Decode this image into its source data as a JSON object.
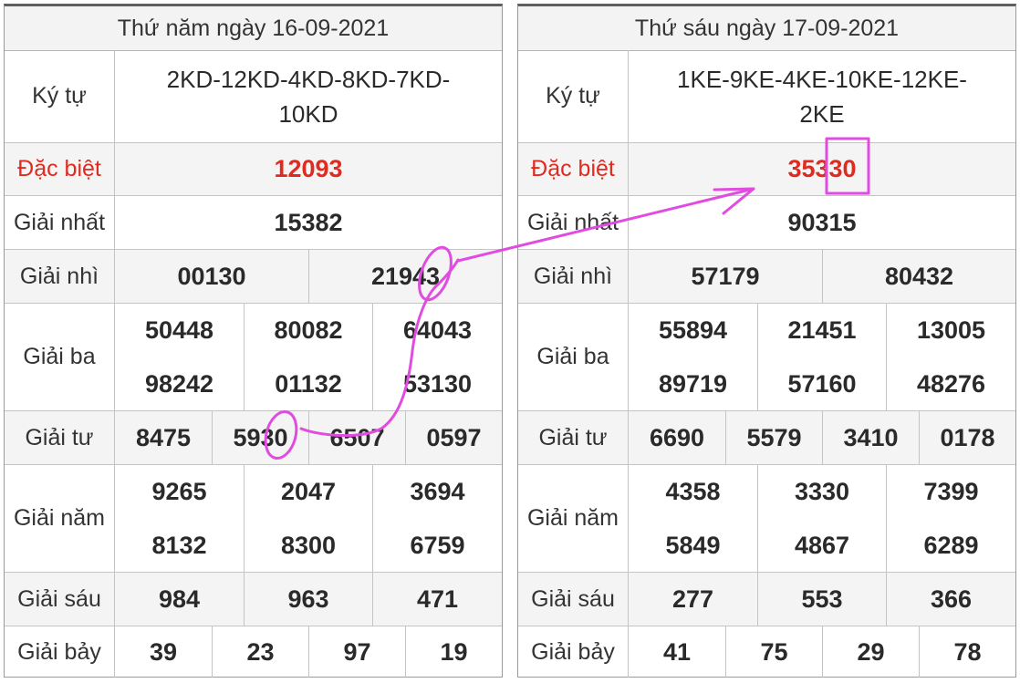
{
  "left": {
    "title": "Thứ năm ngày 16-09-2021",
    "labels": {
      "ky_tu": "Ký tự",
      "dac_biet": "Đặc biệt",
      "nhat": "Giải nhất",
      "nhi": "Giải nhì",
      "ba": "Giải ba",
      "tu": "Giải tư",
      "nam": "Giải năm",
      "sau": "Giải sáu",
      "bay": "Giải bảy"
    },
    "ky_tu": "2KD-12KD-4KD-8KD-7KD-10KD",
    "dac_biet": "12093",
    "nhat": "15382",
    "nhi": [
      "00130",
      "21943"
    ],
    "ba": [
      "50448",
      "80082",
      "64043",
      "98242",
      "01132",
      "53130"
    ],
    "tu": [
      "8475",
      "5930",
      "6507",
      "0597"
    ],
    "nam": [
      "9265",
      "2047",
      "3694",
      "8132",
      "8300",
      "6759"
    ],
    "sau": [
      "984",
      "963",
      "471"
    ],
    "bay": [
      "39",
      "23",
      "97",
      "19"
    ]
  },
  "right": {
    "title": "Thứ sáu ngày 17-09-2021",
    "labels": {
      "ky_tu": "Ký tự",
      "dac_biet": "Đặc biệt",
      "nhat": "Giải nhất",
      "nhi": "Giải nhì",
      "ba": "Giải ba",
      "tu": "Giải tư",
      "nam": "Giải năm",
      "sau": "Giải sáu",
      "bay": "Giải bảy"
    },
    "ky_tu": "1KE-9KE-4KE-10KE-12KE-2KE",
    "dac_biet": "35330",
    "nhat": "90315",
    "nhi": [
      "57179",
      "80432"
    ],
    "ba": [
      "55894",
      "21451",
      "13005",
      "89719",
      "57160",
      "48276"
    ],
    "tu": [
      "6690",
      "5579",
      "3410",
      "0178"
    ],
    "nam": [
      "4358",
      "3330",
      "7399",
      "5849",
      "4867",
      "6289"
    ],
    "sau": [
      "277",
      "553",
      "366"
    ],
    "bay": [
      "41",
      "75",
      "29",
      "78"
    ]
  },
  "colors": {
    "highlight_red": "#e02b20",
    "annotation_magenta": "#e04ce0"
  }
}
